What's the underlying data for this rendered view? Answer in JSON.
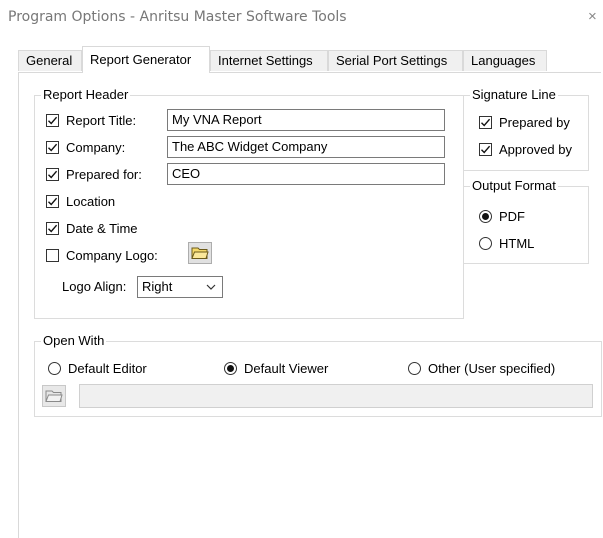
{
  "window": {
    "title": "Program Options - Anritsu Master Software Tools",
    "close_glyph": "×"
  },
  "tabs": [
    {
      "label": "General",
      "active": false
    },
    {
      "label": "Report Generator",
      "active": true
    },
    {
      "label": "Internet Settings",
      "active": false
    },
    {
      "label": "Serial Port Settings",
      "active": false
    },
    {
      "label": "Languages",
      "active": false
    }
  ],
  "report_header": {
    "title": "Report Header",
    "report_title": {
      "label": "Report Title:",
      "checked": true,
      "value": "My VNA Report"
    },
    "company": {
      "label": "Company:",
      "checked": true,
      "value": "The ABC Widget Company"
    },
    "prepared_for": {
      "label": "Prepared for:",
      "checked": true,
      "value": "CEO"
    },
    "location": {
      "label": "Location",
      "checked": true
    },
    "date_time": {
      "label": "Date & Time",
      "checked": true
    },
    "company_logo": {
      "label": "Company Logo:",
      "checked": false
    },
    "logo_align": {
      "label": "Logo Align:",
      "value": "Right"
    }
  },
  "signature_line": {
    "title": "Signature Line",
    "prepared_by": {
      "label": "Prepared by",
      "checked": true
    },
    "approved_by": {
      "label": "Approved by",
      "checked": true
    }
  },
  "output_format": {
    "title": "Output Format",
    "pdf": {
      "label": "PDF",
      "selected": true
    },
    "html": {
      "label": "HTML",
      "selected": false
    }
  },
  "open_with": {
    "title": "Open With",
    "default_editor": {
      "label": "Default Editor",
      "selected": false
    },
    "default_viewer": {
      "label": "Default Viewer",
      "selected": true
    },
    "other": {
      "label": "Other (User specified)",
      "selected": false
    },
    "path_value": ""
  },
  "icons": {
    "check": "checkmark-icon",
    "folder": "folder-icon",
    "chevron": "chevron-down-icon",
    "close": "close-icon"
  },
  "colors": {
    "folder_yellow": "#f5d96b",
    "folder_outline": "#6b5a1a",
    "border": "#d9d9d9"
  }
}
